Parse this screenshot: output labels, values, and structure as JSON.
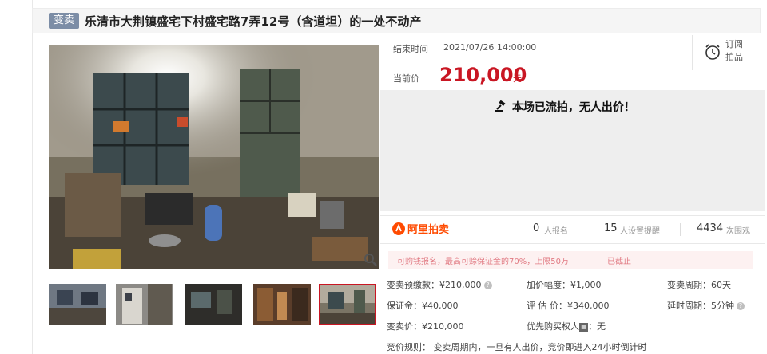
{
  "title": {
    "tag": "变卖",
    "text": "乐清市大荆镇盛宅下村盛宅路7弄12号（含道坦）的一处不动产"
  },
  "auction": {
    "end_label": "结束时间",
    "end_time": "2021/07/26 14:00:00",
    "price_label": "当前价",
    "price": "210,000",
    "price_unit": "元",
    "subscribe_line1": "订阅",
    "subscribe_line2": "拍品",
    "status_msg": "本场已流拍，无人出价！"
  },
  "stats": {
    "brand": "阿里拍卖",
    "signup_count": "0",
    "signup_label": "人报名",
    "reminder_count": "15",
    "reminder_label": "人设置提醒",
    "view_count": "4434",
    "view_label": "次围观"
  },
  "notice": {
    "text": "可购钱报名，最高可赊保证金的70%，上限50万",
    "status": "已截止"
  },
  "details": {
    "deposit": "变卖预缴款：¥210,000",
    "increment": "加价幅度：¥1,000",
    "period": "变卖周期：60天",
    "guarantee": "保证金：¥40,000",
    "appraisal": "评 估 价：¥340,000",
    "delay": "延时周期：5分钟",
    "sale_price": "变卖价：¥210,000",
    "priority_label": "优先购买权人",
    "priority_value": "：无",
    "rules": "竞价规则：  变卖周期内，一旦有人出价，竞价即进入24小时倒计时"
  },
  "colors": {
    "accent": "#c91623",
    "brand": "#ff4a00",
    "tag_bg": "#7c8da6"
  }
}
